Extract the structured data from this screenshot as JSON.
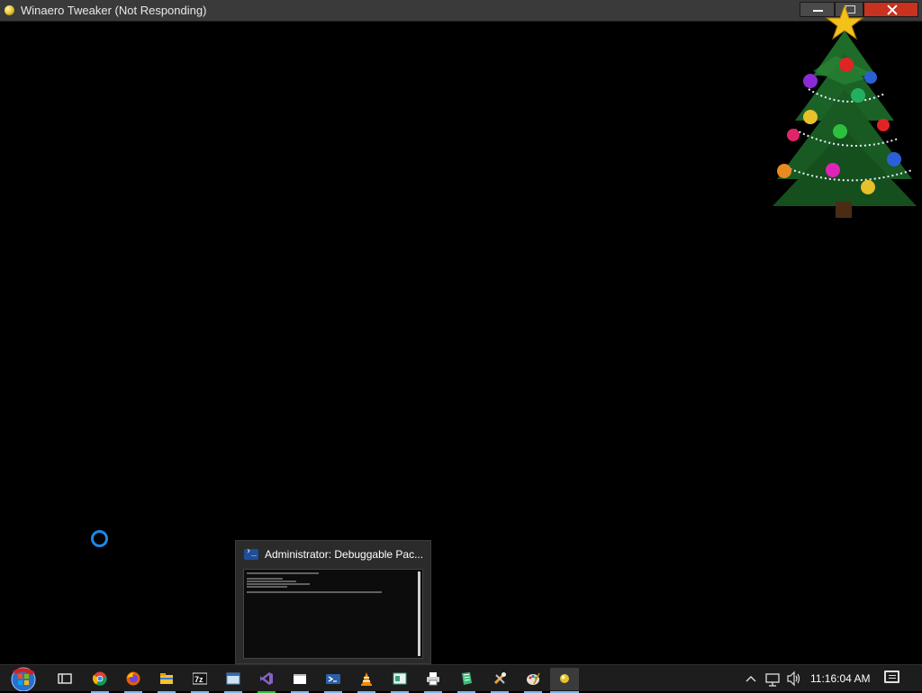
{
  "window": {
    "title": "Winaero Tweaker (Not Responding)"
  },
  "thumbnail": {
    "title": "Administrator: Debuggable Pac...",
    "icon": "powershell-icon"
  },
  "taskbar": {
    "start_icon": "start-orb-icon",
    "items": [
      {
        "name": "task-view-icon",
        "label": "Task View"
      },
      {
        "name": "chrome-icon",
        "label": "Google Chrome"
      },
      {
        "name": "firefox-icon",
        "label": "Firefox"
      },
      {
        "name": "file-explorer-icon",
        "label": "File Explorer"
      },
      {
        "name": "7zip-icon",
        "label": "7z"
      },
      {
        "name": "window-app-icon",
        "label": "App"
      },
      {
        "name": "visual-studio-icon",
        "label": "Visual Studio"
      },
      {
        "name": "blank-window-icon",
        "label": "Window"
      },
      {
        "name": "powershell-icon",
        "label": "PowerShell"
      },
      {
        "name": "vlc-icon",
        "label": "VLC"
      },
      {
        "name": "terminal-app-icon",
        "label": "App"
      },
      {
        "name": "printer-app-icon",
        "label": "App"
      },
      {
        "name": "notepad-app-icon",
        "label": "App"
      },
      {
        "name": "tools-icon",
        "label": "Tools"
      },
      {
        "name": "paint-icon",
        "label": "Paint"
      },
      {
        "name": "winaero-tweaker-icon",
        "label": "Winaero Tweaker"
      }
    ],
    "clock": "11:16:04 AM"
  },
  "colors": {
    "accent": "#76b9ed",
    "close": "#c8321f"
  }
}
